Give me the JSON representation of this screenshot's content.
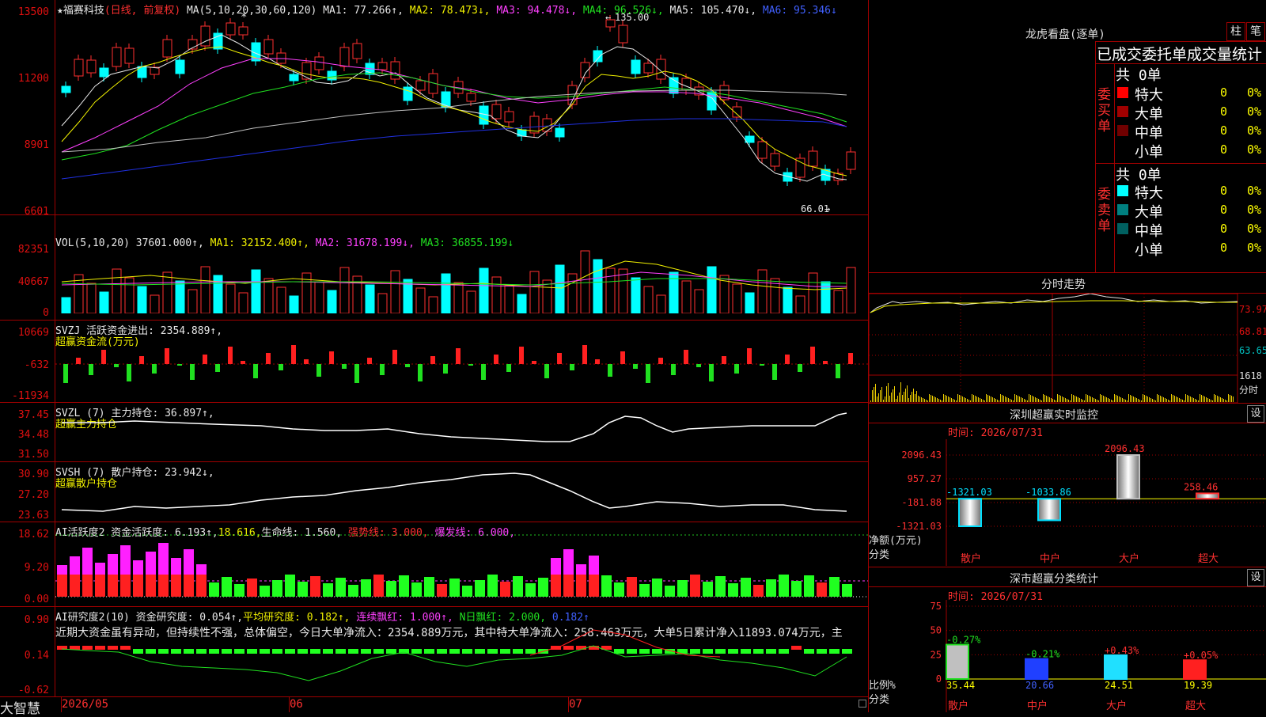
{
  "main": {
    "title_star": "★",
    "stock_name": "福赛科技",
    "period": "(日线, 前复权)",
    "ma_header": "MA(5,10,20,30,60,120)",
    "ma1": "MA1: 77.266↑,",
    "ma2": "MA2: 78.473↓,",
    "ma3": "MA3: 94.478↓,",
    "ma4": "MA4: 96.526↓,",
    "ma5": "MA5: 105.470↓,",
    "ma6": "MA6: 95.346↓",
    "y_labels": [
      "13500",
      "11200",
      "8901",
      "6601"
    ],
    "high_label": "135.00",
    "low_label": "66.01",
    "star_marker": "*"
  },
  "vol": {
    "header": "VOL(5,10,20)",
    "vol": "37601.000↑,",
    "ma1": "MA1: 32152.400↑,",
    "ma2": "MA2: 31678.199↓,",
    "ma3": "MA3: 36855.199↓",
    "y_labels": [
      "82351",
      "40667",
      "0"
    ]
  },
  "svzj": {
    "header": "SVZJ  活跃资金进出: 2354.889↑,",
    "sub": "超赢资金流(万元)",
    "y_labels": [
      "10669",
      "-632",
      "-11934"
    ]
  },
  "svzl": {
    "header": "SVZL (7) 主力持仓: 36.897↑,",
    "sub": "超赢主力持仓",
    "y_labels": [
      "37.45",
      "34.48",
      "31.50"
    ]
  },
  "svsh": {
    "header": "SVSH (7) 散户持仓: 23.942↓,",
    "sub": "超赢散户持仓",
    "y_labels": [
      "30.90",
      "27.20",
      "23.63"
    ]
  },
  "ai1": {
    "header_a": "AI活跃度2 资金活跃度: 6.193↑,",
    "header_b": "18.616,",
    "header_c": "生命线: 1.560,",
    "header_d": "强势线: 3.000,",
    "header_e": "爆发线: 6.000,",
    "y_labels": [
      "18.62",
      "9.20",
      "0.00"
    ]
  },
  "ai2": {
    "header_a": "AI研究度2(10) 资金研究度: 0.054↑,",
    "header_b": "平均研究度: 0.182↑,",
    "header_c": "连续飘红: 1.000↑,",
    "header_d": "N日飘红: 2.000,",
    "header_e": "0.182↑",
    "comment": "近期大资金虽有异动，但持续性不强，总体偏空，今日大单净流入：2354.889万元，其中特大单净流入：258.463万元，大单5日累计净入11893.074万元，主",
    "y_labels": [
      "0.90",
      "0.14",
      "-0.62"
    ]
  },
  "footer": {
    "brand": "大智慧",
    "dates": [
      "2026/05",
      "06",
      "07"
    ]
  },
  "dragon": {
    "title": "龙虎看盘(逐单)",
    "tab1": "柱",
    "tab2": "笔",
    "subtitle": "已成交委托单成交量统计",
    "buy_label": "委买单",
    "sell_label": "委卖单",
    "buy_total": "共 0单",
    "sell_total": "共 0单",
    "buy_rows": [
      {
        "name": "特大",
        "count": "0",
        "pct": "0%",
        "color": "#ff0000"
      },
      {
        "name": "大单",
        "count": "0",
        "pct": "0%",
        "color": "#a00000"
      },
      {
        "name": "中单",
        "count": "0",
        "pct": "0%",
        "color": "#700000"
      },
      {
        "name": "小单",
        "count": "0",
        "pct": "0%",
        "color": ""
      }
    ],
    "sell_rows": [
      {
        "name": "特大",
        "count": "0",
        "pct": "0%",
        "color": "#00ffff"
      },
      {
        "name": "大单",
        "count": "0",
        "pct": "0%",
        "color": "#008080"
      },
      {
        "name": "中单",
        "count": "0",
        "pct": "0%",
        "color": "#006060"
      },
      {
        "name": "小单",
        "count": "0",
        "pct": "0%",
        "color": ""
      }
    ]
  },
  "intraday": {
    "title": "分时走势",
    "y_labels": [
      "73.97",
      "68.81",
      "63.65",
      "1618",
      "分时"
    ]
  },
  "sz_monitor": {
    "title": "深圳超赢实时监控",
    "set": "设",
    "time": "时间: 2026/07/31",
    "y_labels": [
      "2096.43",
      "957.27",
      "-181.88",
      "-1321.03"
    ],
    "y_title": "净额(万元)",
    "x_title": "分类",
    "categories": [
      "散户",
      "中户",
      "大户",
      "超大"
    ],
    "values": [
      -1321.03,
      -1033.86,
      2096.43,
      258.46
    ],
    "value_labels": [
      "-1321.03",
      "-1033.86",
      "2096.43",
      "258.46"
    ]
  },
  "sz_class": {
    "title": "深市超赢分类统计",
    "set": "设",
    "time": "时间: 2026/07/31",
    "y_labels": [
      "75",
      "50",
      "25",
      "0"
    ],
    "y_title": "比例%",
    "x_title": "分类",
    "categories": [
      "散户",
      "中户",
      "大户",
      "超大"
    ],
    "values": [
      35.44,
      20.66,
      24.51,
      19.39
    ],
    "value_labels": [
      "35.44",
      "20.66",
      "24.51",
      "19.39"
    ],
    "changes": [
      "-0.27%",
      "-0.21%",
      "+0.43%",
      "+0.05%"
    ]
  },
  "chart_data": {
    "type": "bar",
    "title": "深圳超赢实时监控",
    "categories": [
      "散户",
      "中户",
      "大户",
      "超大"
    ],
    "series": [
      {
        "name": "净额(万元)",
        "values": [
          -1321.03,
          -1033.86,
          2096.43,
          258.46
        ]
      },
      {
        "name": "比例%",
        "values": [
          35.44,
          20.66,
          24.51,
          19.39
        ]
      }
    ],
    "ylim": [
      -1321.03,
      2096.43
    ]
  }
}
